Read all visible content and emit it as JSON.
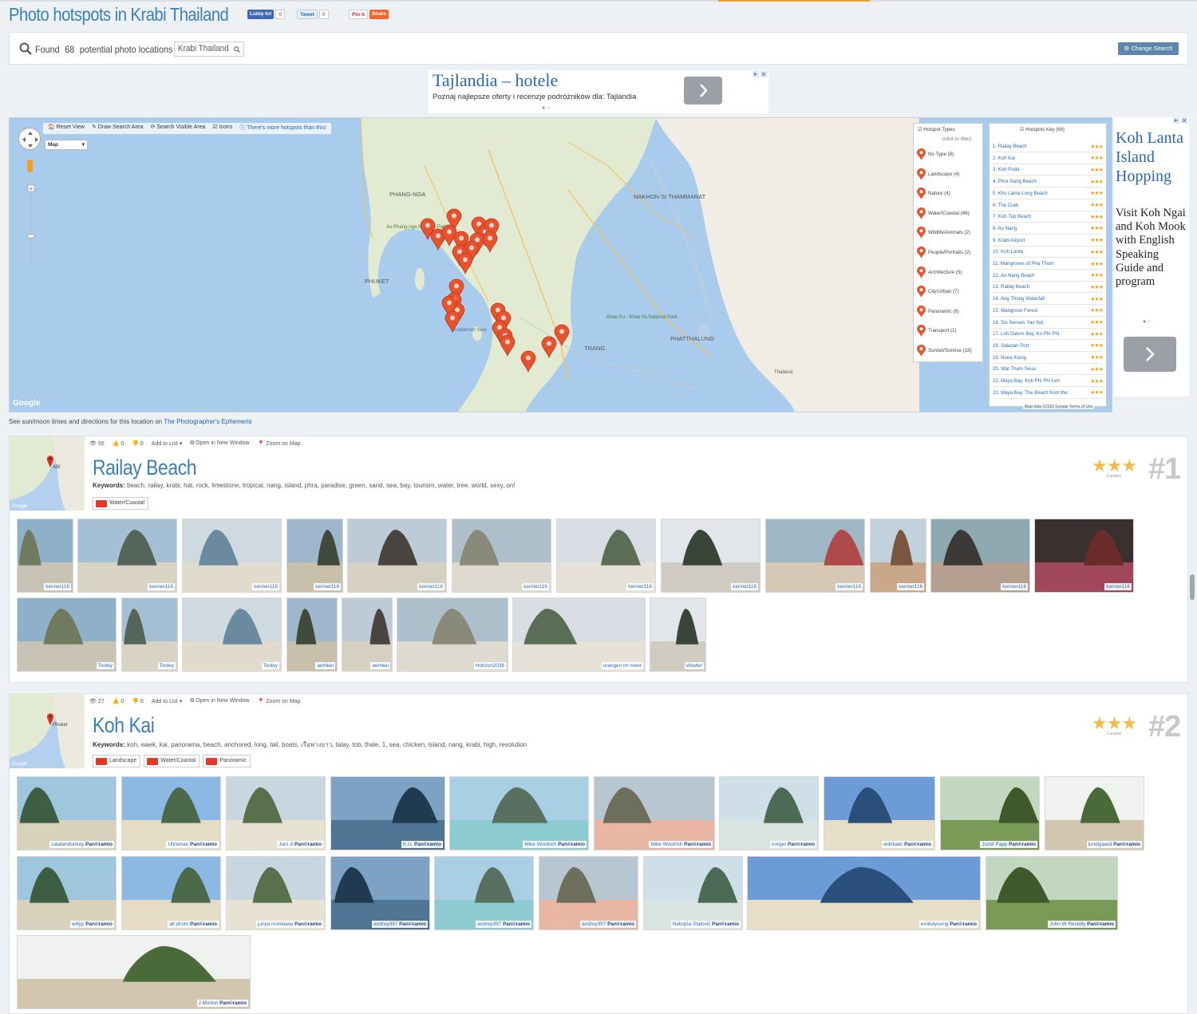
{
  "page": {
    "title": "Photo hotspots in Krabi Thailand",
    "colors": {
      "accent": "#3b7fb6",
      "pin": "#e8532f",
      "star": "#f2bb4a"
    }
  },
  "social": {
    "facebook_label": "Lubię to!",
    "facebook_count": "0",
    "twitter_label": "Tweet",
    "twitter_count": "0",
    "pinterest_label": "Pin it",
    "share_label": "Share"
  },
  "search": {
    "prefix": "Found",
    "count": "68",
    "middle": "potential photo locations in",
    "location": "Krabi Thailand",
    "change_label": "Change Search"
  },
  "ad_top": {
    "headline": "Tajlandia – hotele",
    "text": "Poznaj najlepsze oferty i recenzje podróżników dla: Tajlandia"
  },
  "map": {
    "toolbar": {
      "reset": "Reset View",
      "draw": "Draw Search Area",
      "visible": "Search Visible Area",
      "icons": "Icons",
      "more": "There's more hotspots than this!"
    },
    "map_type": "Map",
    "attribution": "Map data ©2015 Google   Terms of Use",
    "google": "Google",
    "labels": [
      "PHANG-NGA",
      "NAKHON SI THAMMARAT",
      "PHUKET",
      "TRANG",
      "PHATTHALUNG",
      "Andaman Sea",
      "Ao Phang-nga National Park",
      "Khao Pu - Khao Ya National Park",
      "Thailand"
    ],
    "types_title": "Hotspot Types",
    "types_subtitle": "(click to filter)",
    "types": [
      "No Type (8)",
      "Landscape (4)",
      "Nature (4)",
      "Water/Coastal (46)",
      "Wildlife/Animals (2)",
      "People/Portraits (2)",
      "Architecture (5)",
      "City/Urban (7)",
      "Panoramic (6)",
      "Transport (1)",
      "Sunset/Sunrise (18)"
    ],
    "key_title": "Hotspots Key (68)",
    "key": [
      "1. Railay Beach",
      "2. Koh Kai",
      "3. Koh Poda",
      "4. Phra Nang Beach",
      "5. Kho Lanta Long Beach",
      "6. The Crab",
      "7. Koh Tup Beach",
      "8. Ao Nang",
      "9. Krabi Airport",
      "10. Koh Lanta",
      "11. Mangroves of Pha Thom",
      "12. Ao Nang Beach",
      "13. Railay Beach",
      "14. Ang Thong Waterfall",
      "15. Mangrove Forest",
      "16. Six Senses Yao Noi",
      "17. Loh Dalum Bay, Ko Phi Phi",
      "18. Saladan Port",
      "19. Noea Klong",
      "20. Wat Tham Seua",
      "21. Maya Bay, Koh Phi Phi Leh",
      "22. Maya Bay. The Beach from the"
    ]
  },
  "ad_side": {
    "headline": "Koh Lanta Island Hopping",
    "text": "Visit Koh Ngai and Koh Mook with English Speaking Guide and program"
  },
  "ephemeris": {
    "text": "See sun/moon times and directions for this location on",
    "link": "The Photographer's Ephemeris"
  },
  "results": [
    {
      "views": "55",
      "likes": "0",
      "dislikes": "0",
      "add_list": "Add to List",
      "open": "Open in New Window",
      "zoom": "Zoom on Map",
      "name": "Railay Beach",
      "keywords_label": "Keywords:",
      "keywords": "beach, railay, krabi, hat, rock, limestone, tropical, nang, island, phra, paradise, green, sand, sea, bay, tourism, water, tree, world, sexy, on!",
      "tags": [
        "Water/Coastal"
      ],
      "curated": "Curated",
      "rank": "#1",
      "map_label": "ABI",
      "photos": [
        {
          "credit": "kenner116",
          "pano": false
        },
        {
          "credit": "kenner116",
          "pano": false
        },
        {
          "credit": "kenner116",
          "pano": false
        },
        {
          "credit": "kenner116",
          "pano": false
        },
        {
          "credit": "kenner116",
          "pano": false
        },
        {
          "credit": "kenner116",
          "pano": false
        },
        {
          "credit": "kenner116",
          "pano": false
        },
        {
          "credit": "kenner116",
          "pano": false
        },
        {
          "credit": "kenner116",
          "pano": false
        },
        {
          "credit": "kenner116",
          "pano": false
        },
        {
          "credit": "kenner116",
          "pano": false
        },
        {
          "credit": "kenner116",
          "pano": false
        },
        {
          "credit": "Tooley",
          "pano": false
        },
        {
          "credit": "Tooley",
          "pano": false
        },
        {
          "credit": "Tooley",
          "pano": false
        },
        {
          "credit": "aemkei",
          "pano": false
        },
        {
          "credit": "aemkei",
          "pano": false
        },
        {
          "credit": "Horizon2036",
          "pano": false
        },
        {
          "credit": "orangen im meer",
          "pano": false
        },
        {
          "credit": "vfowler",
          "pano": false
        }
      ]
    },
    {
      "views": "27",
      "likes": "0",
      "dislikes": "0",
      "add_list": "Add to List",
      "open": "Open in New Window",
      "zoom": "Zoom on Map",
      "name": "Koh Kai",
      "keywords_label": "Keywords:",
      "keywords": "koh, waek, kai, panorama, beach, anchored, long, tail, boats, เรือหางยาว, talay, tob, thale, 1, sea, chicken, island, nang, krabi, high, resolution",
      "tags": [
        "Landscape",
        "Water/Coastal",
        "Panoramic"
      ],
      "curated": "Curated",
      "rank": "#2",
      "map_label": "Phuket",
      "photos": [
        {
          "credit": "catalandonkey",
          "pano": true
        },
        {
          "credit": "Ultraman",
          "pano": true
        },
        {
          "credit": "Joni Ji",
          "pano": true
        },
        {
          "credit": "K.U.",
          "pano": true
        },
        {
          "credit": "Mike Woolrich",
          "pano": true
        },
        {
          "credit": "Mike Woolrich",
          "pano": true
        },
        {
          "credit": "norger",
          "pano": true
        },
        {
          "credit": "vidrikalic",
          "pano": true
        },
        {
          "credit": "Jozef Papp",
          "pano": true
        },
        {
          "credit": "lundigaard",
          "pano": true
        },
        {
          "credit": "willyp",
          "pano": true
        },
        {
          "credit": "all photo",
          "pano": true
        },
        {
          "credit": "junya morikawa",
          "pano": true
        },
        {
          "credit": "andrey397",
          "pano": true
        },
        {
          "credit": "andrey397",
          "pano": true
        },
        {
          "credit": "andrey397",
          "pano": true
        },
        {
          "credit": "Nebojša Stalović",
          "pano": true
        },
        {
          "credit": "emikayoung",
          "pano": true
        },
        {
          "credit": "John W Reskilly",
          "pano": true
        },
        {
          "credit": "J Morton",
          "pano": true
        }
      ],
      "pano_mark": "Pan©ramio"
    }
  ]
}
